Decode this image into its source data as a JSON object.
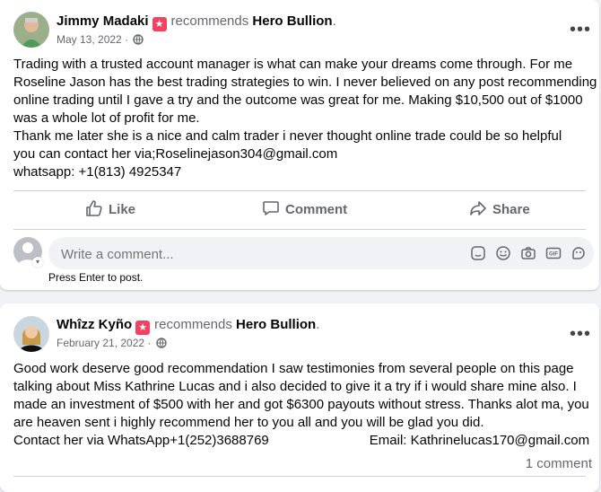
{
  "post1": {
    "author": "Jimmy Madaki",
    "recommends_text": "recommends",
    "page_name": "Hero Bullion",
    "date": "May 13, 2022",
    "separator": "·",
    "body": {
      "line1": "Trading with a trusted account manager is what can make your dreams come through. For me",
      "line2": "Roseline Jason has the best trading strategies to win. I never believed on any post recommending",
      "line3": "online trading until I gave a try and the outcome was great for me. Making $10,500 out of $1000",
      "line4": "was a whole lot of profit for me.",
      "line5": "Thank me later she is a nice and calm trader i never thought online trade could be so helpful",
      "line6": "you can contact her via;Roselinejason304@gmail.com",
      "line7": "whatsapp: +1(813) 4925347"
    },
    "actions": {
      "like": "Like",
      "comment": "Comment",
      "share": "Share"
    },
    "comment_placeholder": "Write a comment...",
    "press_enter": "Press Enter to post."
  },
  "post2": {
    "author": "Whîzz Kyño",
    "recommends_text": "recommends",
    "page_name": "Hero Bullion",
    "date": "February 21, 2022",
    "separator": "·",
    "body": {
      "line1": "Good work deserve good recommendation  I saw testimonies from several people on this page",
      "line2": "talking about Miss Kathrine Lucas and i also decided to give it a try if i would share mine also. I",
      "line3": "made an investment of $500 with her and got $6300 payouts without stress. Thanks alot ma, you",
      "line4": "are heaven sent i highly recommend her to you all and you will be glad you did.",
      "line5a": "Contact her via WhatsApp+1(252)3688769",
      "line5b": "Email: Kathrinelucas170@gmail.com"
    },
    "comment_count": "1 comment"
  },
  "colors": {
    "badge": "#f3425f",
    "secondary_text": "#65676b",
    "background": "#f0f2f5"
  },
  "icons": [
    "more-options-icon",
    "globe-icon",
    "like-icon",
    "comment-icon",
    "share-icon",
    "avatar-placeholder-icon",
    "sticker-icon",
    "emoji-icon",
    "camera-icon",
    "gif-icon",
    "avatar-sticker-icon"
  ]
}
